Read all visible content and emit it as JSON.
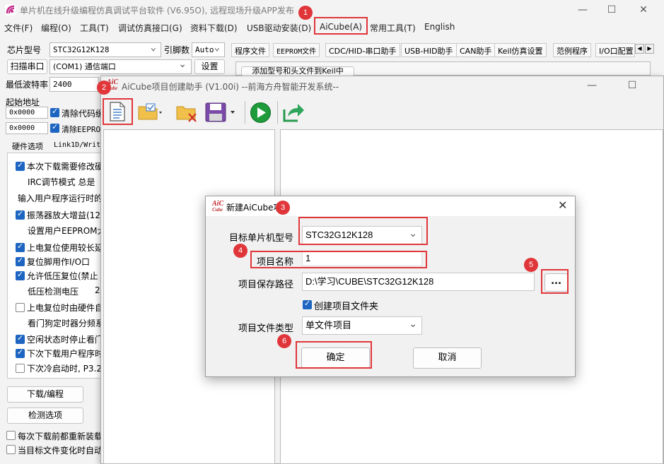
{
  "main": {
    "title": "单片机在线升级编程仿真调试平台软件 (V6.95O), 远程现场升级APP发布",
    "menu": [
      "文件(F)",
      "编程(O)",
      "工具(T)",
      "调试仿真接口(G)",
      "资料下载(D)",
      "USB驱动安装(D)",
      "AiCube(A)",
      "常用工具(T)",
      "English"
    ],
    "chip_label": "芯片型号",
    "chip_value": "STC32G12K128",
    "pin_label": "引脚数",
    "pin_value": "Auto",
    "scan_button": "扫描串口",
    "port_value": "(COM1) 通信端口",
    "settings_button": "设置",
    "baud_label": "最低波特率",
    "baud_value": "2400",
    "start_addr_label": "起始地址",
    "addr1": "0x0000",
    "addr2": "0x0000",
    "clear_code": "清除代码缓",
    "clear_eeprom": "清除EEPROM",
    "hw_tab": "硬件选项",
    "link_tab": "Link1D/Writ",
    "options": [
      {
        "text": "本次下载需要修改硬",
        "checked": true
      },
      {
        "text": "IRC调节模式   总是",
        "checked": null
      },
      {
        "text": "输入用户程序运行时的",
        "checked": null
      },
      {
        "text": "振荡器放大增益(12",
        "checked": true
      },
      {
        "text": "设置用户EEPROM大小",
        "checked": null
      },
      {
        "text": "上电复位使用较长延",
        "checked": true
      },
      {
        "text": "复位脚用作I/O口",
        "checked": true
      },
      {
        "text": "允许低压复位(禁止",
        "checked": true
      },
      {
        "text": "低压检测电压",
        "checked": null
      },
      {
        "text": "上电复位时由硬件自",
        "checked": false
      },
      {
        "text": "看门狗定时器分频系",
        "checked": null
      },
      {
        "text": "空闲状态时停止看门",
        "checked": true
      },
      {
        "text": "下次下载用户程序时",
        "checked": true
      },
      {
        "text": "下次冷启动时, P3.2",
        "checked": false
      }
    ],
    "lv_value": "2",
    "download_button": "下载/编程",
    "check_button": "检测选项",
    "reload_each": "每次下载前都重新装载",
    "auto_reload": "当目标文件变化时自动",
    "tabs": [
      "程序文件",
      "EEPROM文件",
      "CDC/HID-串口助手",
      "USB-HID助手",
      "CAN助手",
      "Keil仿真设置",
      "范例程序",
      "I/O口配置"
    ],
    "keil_button": "添加型号和头文件到Keil中"
  },
  "aicube": {
    "title": "AiCube项目创建助手 (V1.00i) --前海方舟智能开发系统--",
    "toolbar_icons": [
      "new-file-icon",
      "open-folder-icon",
      "delete-folder-icon",
      "save-icon",
      "run-icon",
      "export-icon"
    ]
  },
  "dialog": {
    "title": "新建AiCube项目",
    "mcu_label": "目标单片机型号",
    "mcu_value": "STC32G12K128",
    "name_label": "项目名称",
    "name_value": "1",
    "path_label": "项目保存路径",
    "path_value": "D:\\学习\\CUBE\\STC32G12K128",
    "browse_button": "...",
    "create_folder": "创建项目文件夹",
    "type_label": "项目文件类型",
    "type_value": "单文件项目",
    "ok_button": "确定",
    "cancel_button": "取消"
  },
  "logo_text": "AiC\nCube",
  "badges": [
    "1",
    "2",
    "3",
    "4",
    "5",
    "6"
  ],
  "colors": {
    "accent_red": "#e0363a",
    "check_blue": "#1d65c1",
    "run_green": "#1e9b3a"
  }
}
